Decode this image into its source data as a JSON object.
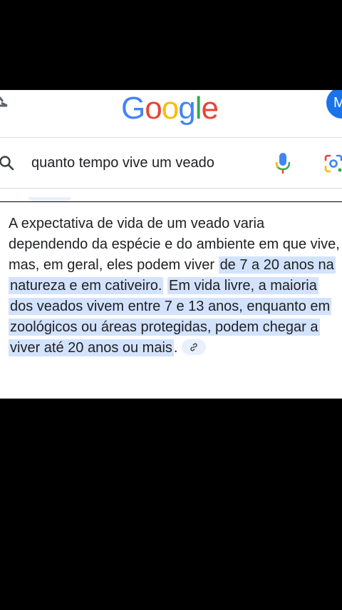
{
  "header": {
    "logo_letters": [
      "G",
      "o",
      "o",
      "g",
      "l",
      "e"
    ],
    "avatar_initial": "M",
    "icons": {
      "menu": "menu-icon",
      "avatar": "account-avatar"
    }
  },
  "search": {
    "query": "quanto tempo vive um veado",
    "icons": {
      "search": "search-icon",
      "mic": "microphone-icon",
      "lens": "google-lens-icon"
    }
  },
  "answer": {
    "plain_intro": "A expectativa de vida de um veado varia dependendo da espécie e do ambiente em que vive, mas, em geral, eles podem viver ",
    "highlight_1": "de 7 a 20 anos na natureza e em cativeiro.",
    "highlight_2": "Em vida livre, a maioria dos veados vivem entre 7 e 13 anos, enquanto em zoológicos ou áreas protegidas, podem chegar a viver até 20 anos ou mais",
    "trailing": ".",
    "link_icon": "link-icon"
  },
  "colors": {
    "highlight": "#d3e3fd",
    "google_blue": "#4285F4",
    "google_red": "#EA4335",
    "google_yellow": "#FBBC05",
    "google_green": "#34A853"
  }
}
